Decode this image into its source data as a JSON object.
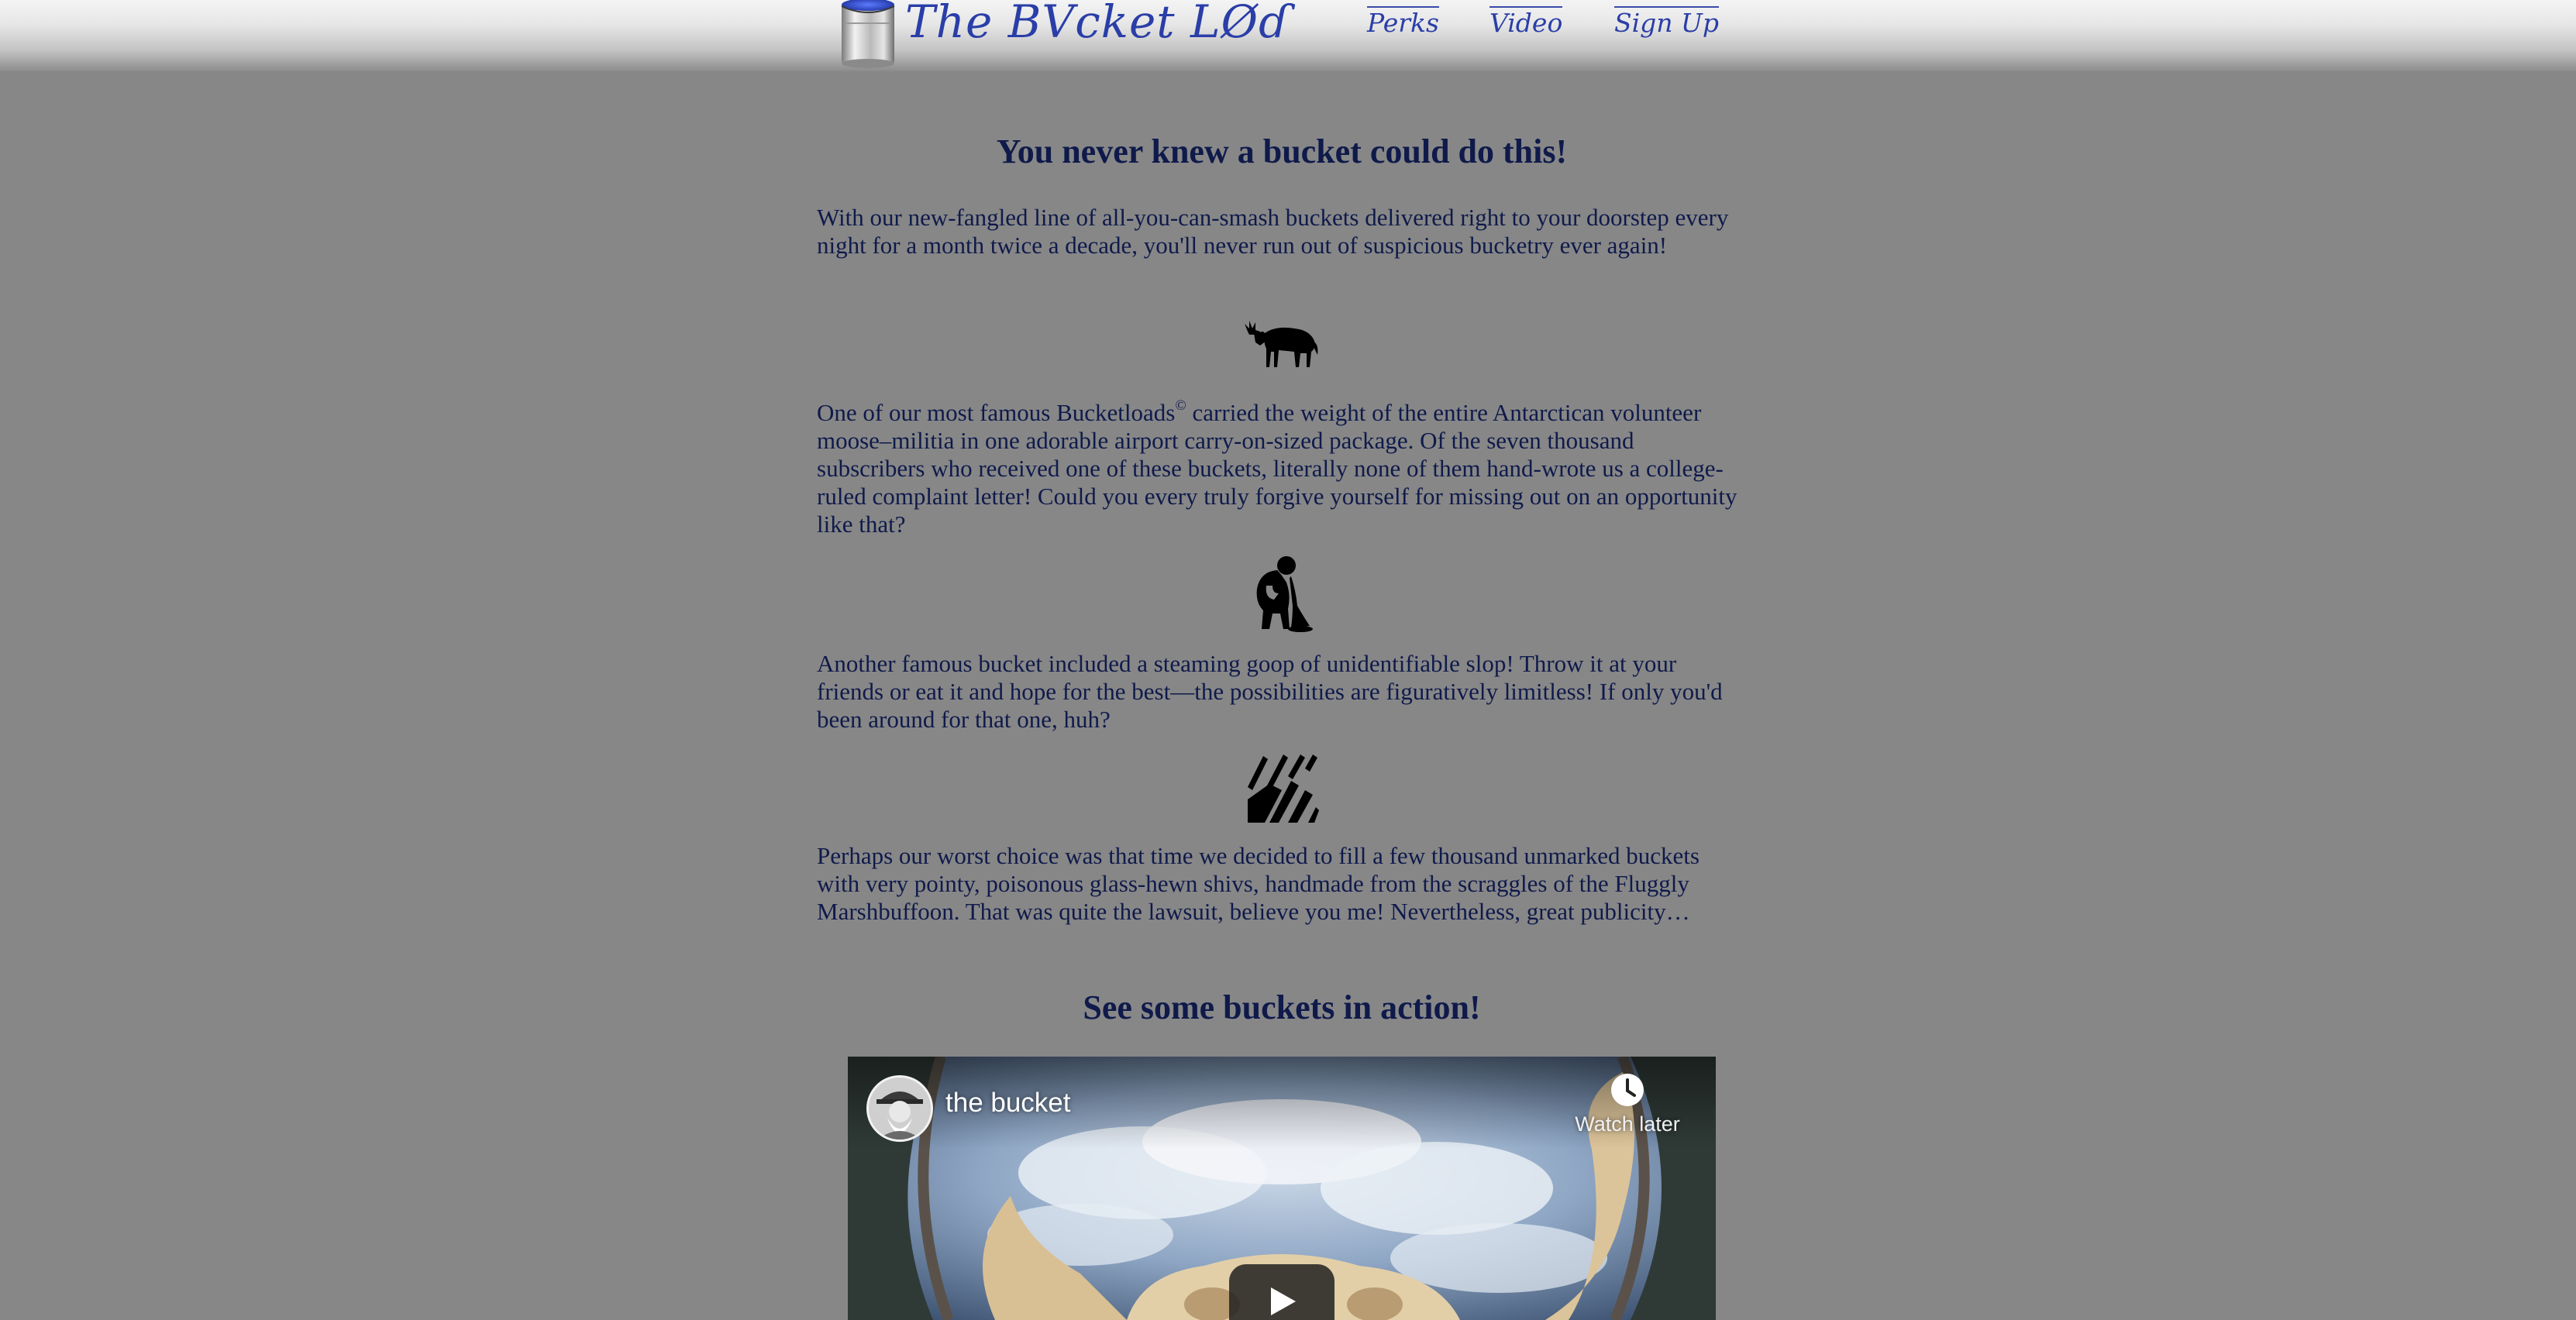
{
  "header": {
    "logo_text": "The BVcket LØɗ",
    "nav": [
      {
        "label": "Perks"
      },
      {
        "label": "Video"
      },
      {
        "label": "Sign Up"
      }
    ]
  },
  "main": {
    "title": "You never knew a bucket could do this!",
    "intro": "With our new-fangled line of all-you-can-smash buckets delivered right to your doorstep every night for a month twice a decade, you'll never run out of suspicious bucketry ever again!",
    "features": [
      {
        "icon": "moose-icon",
        "text_before": "One of our most famous Bucketloads",
        "mark": "©",
        "text_after": " carried the weight of the entire Antarctican volunteer moose–militia in one adorable airport carry-on-sized package. Of the seven thousand subscribers who received one of these buckets, literally none of them hand-wrote us a college-ruled complaint letter! Could you every truly forgive yourself for missing out on an opportunity like that?"
      },
      {
        "icon": "person-vomiting-icon",
        "text": "Another famous bucket included a steaming goop of unidentifiable slop! Throw it at your friends or eat it and hope for the best—the possibilities are figuratively limitless! If only you'd been around for that one, huh?"
      },
      {
        "icon": "shard-rain-icon",
        "text": "Perhaps our worst choice was that time we decided to fill a few thousand unmarked buckets with very pointy, poisonous glass-hewn shivs, handmade from the scraggles of the Fluggly Marshbuffoon. That was quite the lawsuit, believe you me! Nevertheless, great publicity…"
      }
    ],
    "video_heading": "See some buckets in action!"
  },
  "video": {
    "title": "the bucket",
    "watch_later_label": "Watch later"
  },
  "colors": {
    "page_background": "#878787",
    "text": "#0f1a4b",
    "brand_blue": "#2a3ea8"
  }
}
